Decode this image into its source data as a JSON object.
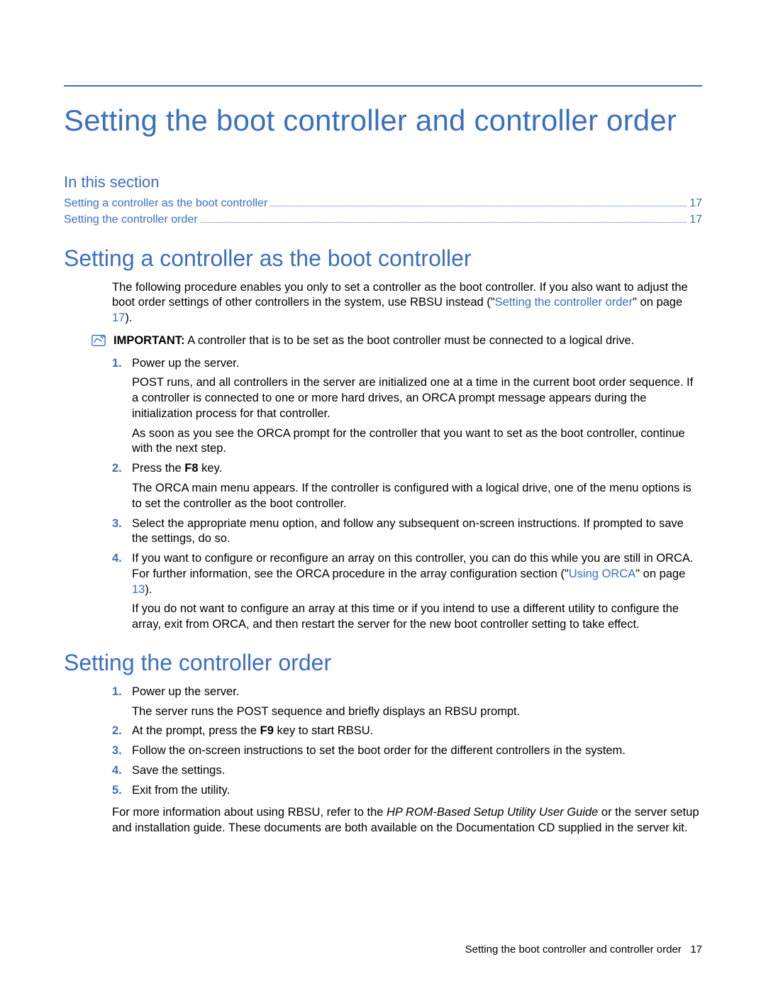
{
  "title": "Setting the boot controller and controller order",
  "section_label": "In this section",
  "toc": [
    {
      "title": "Setting a controller as the boot controller",
      "page": "17"
    },
    {
      "title": "Setting the controller order",
      "page": "17"
    }
  ],
  "h2_1": "Setting a controller as the boot controller",
  "intro_prefix": "The following procedure enables you only to set a controller as the boot controller. If you also want to adjust the boot order settings of other controllers in the system, use RBSU instead (\"",
  "intro_link": "Setting the controller order",
  "intro_mid": "\" on page ",
  "intro_page": "17",
  "intro_suffix": ").",
  "important_label": "IMPORTANT:",
  "important_text": "  A controller that is to be set as the boot controller must be connected to a logical drive.",
  "steps_a": [
    {
      "num": "1",
      "lead": "Power up the server.",
      "paras": [
        "POST runs, and all controllers in the server are initialized one at a time in the current boot order sequence. If a controller is connected to one or more hard drives, an ORCA prompt message appears during the initialization process for that controller.",
        "As soon as you see the ORCA prompt for the controller that you want to set as the boot controller, continue with the next step."
      ]
    },
    {
      "num": "2",
      "lead_pre": "Press the ",
      "lead_bold": "F8",
      "lead_post": " key.",
      "paras": [
        "The ORCA main menu appears. If the controller is configured with a logical drive, one of the menu options is to set the controller as the boot controller."
      ]
    },
    {
      "num": "3",
      "lead": "Select the appropriate menu option, and follow any subsequent on-screen instructions. If prompted to save the settings, do so."
    },
    {
      "num": "4",
      "lead_pre": "If you want to configure or reconfigure an array on this controller, you can do this while you are still in ORCA. For further information, see the ORCA procedure in the array configuration section (\"",
      "lead_link": "Using ORCA",
      "lead_mid": "\" on page ",
      "lead_page": "13",
      "lead_post": ").",
      "paras": [
        "If you do not want to configure an array at this time or if you intend to use a different utility to configure the array, exit from ORCA, and then restart the server for the new boot controller setting to take effect."
      ]
    }
  ],
  "h2_2": "Setting the controller order",
  "steps_b": [
    {
      "num": "1",
      "lead": "Power up the server.",
      "paras": [
        "The server runs the POST sequence and briefly displays an RBSU prompt."
      ]
    },
    {
      "num": "2",
      "lead_pre": "At the prompt, press the ",
      "lead_bold": "F9",
      "lead_post": " key to start RBSU."
    },
    {
      "num": "3",
      "lead": "Follow the on-screen instructions to set the boot order for the different controllers in the system."
    },
    {
      "num": "4",
      "lead": "Save the settings."
    },
    {
      "num": "5",
      "lead": "Exit from the utility."
    }
  ],
  "closing_pre": "For more information about using RBSU, refer to the ",
  "closing_ital": "HP ROM-Based Setup Utility User Guide",
  "closing_post": " or the server setup and installation guide. These documents are both available on the Documentation CD supplied in the server kit.",
  "footer_title": "Setting the boot controller and controller order",
  "footer_page": "17"
}
